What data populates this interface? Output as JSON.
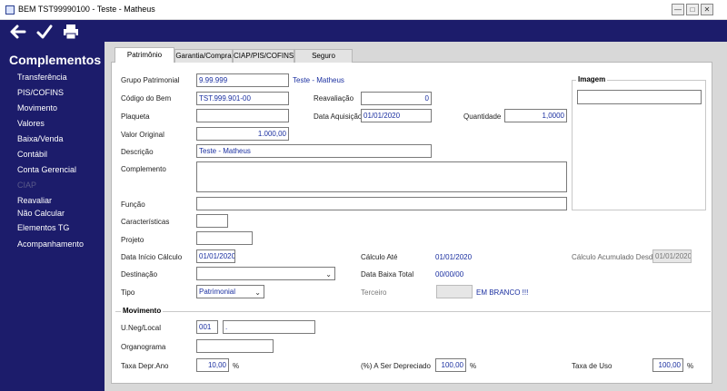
{
  "window": {
    "title": "BEM TST99990100 - Teste - Matheus",
    "minimize": "—",
    "maximize": "□",
    "close": "✕"
  },
  "sidebar": {
    "title": "Complementos",
    "items": [
      {
        "label": "Transferência",
        "disabled": false
      },
      {
        "label": "PIS/COFINS",
        "disabled": false
      },
      {
        "label": "Movimento",
        "disabled": false
      },
      {
        "label": "Valores",
        "disabled": false
      },
      {
        "label": "Baixa/Venda",
        "disabled": false
      },
      {
        "label": "Contábil",
        "disabled": false
      },
      {
        "label": "Conta Gerencial",
        "disabled": false
      },
      {
        "label": "CIAP",
        "disabled": true
      },
      {
        "label": "Reavaliar",
        "disabled": false
      },
      {
        "label": "Não Calcular",
        "disabled": false
      },
      {
        "label": "Elementos TG",
        "disabled": false
      },
      {
        "label": "Acompanhamento",
        "disabled": false
      }
    ]
  },
  "tabs": [
    {
      "label": "Patrimônio",
      "active": true
    },
    {
      "label": "Garantia/Compra",
      "active": false
    },
    {
      "label": "CIAP/PIS/COFINS",
      "active": false
    },
    {
      "label": "Seguro",
      "active": false
    }
  ],
  "form": {
    "grupo_patrimonial": {
      "label": "Grupo Patrimonial",
      "value": "9.99.999",
      "desc": "Teste - Matheus"
    },
    "codigo_bem": {
      "label": "Código do Bem",
      "value": "TST.999.901-00"
    },
    "reavaliacao": {
      "label": "Reavaliação",
      "value": "0"
    },
    "plaqueta": {
      "label": "Plaqueta",
      "value": ""
    },
    "data_aquisicao": {
      "label": "Data Aquisição",
      "value": "01/01/2020"
    },
    "quantidade": {
      "label": "Quantidade",
      "value": "1,0000"
    },
    "valor_original": {
      "label": "Valor Original",
      "value": "1.000,00"
    },
    "descricao": {
      "label": "Descrição",
      "value": "Teste - Matheus"
    },
    "complemento": {
      "label": "Complemento",
      "value": ""
    },
    "funcao": {
      "label": "Função",
      "value": ""
    },
    "caracteristicas": {
      "label": "Características",
      "value": ""
    },
    "projeto": {
      "label": "Projeto",
      "value": ""
    },
    "data_inicio_calculo": {
      "label": "Data Início Cálculo",
      "value": "01/01/2020"
    },
    "calculo_ate": {
      "label": "Cálculo Até",
      "value": "01/01/2020"
    },
    "calculo_acumulado_desde": {
      "label": "Cálculo Acumulado Desde",
      "value": "01/01/2020"
    },
    "destinacao": {
      "label": "Destinação",
      "value": ""
    },
    "data_baixa_total": {
      "label": "Data Baixa Total",
      "value": "00/00/00"
    },
    "tipo": {
      "label": "Tipo",
      "value": "Patrimonial"
    },
    "terceiro": {
      "label": "Terceiro",
      "value": "",
      "status": "EM BRANCO !!!"
    },
    "imagem": {
      "label": "Imagem",
      "value": ""
    }
  },
  "movimento": {
    "title": "Movimento",
    "uneg_local": {
      "label": "U.Neg/Local",
      "code": "001",
      "value": "."
    },
    "organograma": {
      "label": "Organograma",
      "value": ""
    },
    "taxa_depr_ano": {
      "label": "Taxa Depr.Ano",
      "value": "10,00",
      "unit": "%"
    },
    "a_ser_depreciado": {
      "label": "(%) A Ser Depreciado",
      "value": "100,00",
      "unit": "%"
    },
    "taxa_uso": {
      "label": "Taxa de Uso",
      "value": "100,00",
      "unit": "%"
    }
  }
}
